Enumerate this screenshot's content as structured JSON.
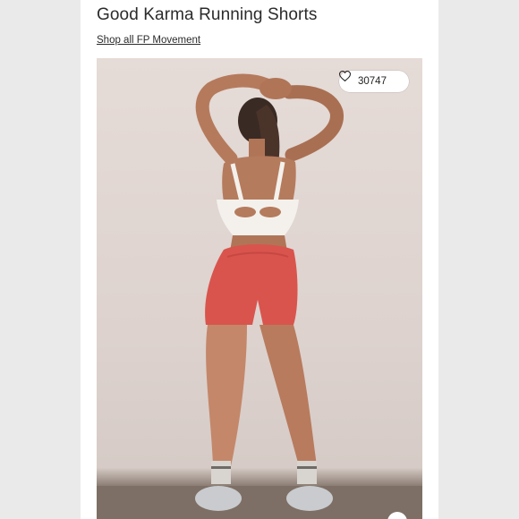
{
  "product": {
    "title": "Good Karma Running Shorts",
    "shop_link": "Shop all FP Movement"
  },
  "image": {
    "alt": "Model wearing red high-waisted running shorts and white sports bra, back view",
    "like_count": "30747",
    "like_icon": "heart-icon"
  },
  "colors": {
    "background": "#e9e9e9",
    "card": "#ffffff",
    "text": "#2b2b2b",
    "shorts": "#d9544d"
  }
}
